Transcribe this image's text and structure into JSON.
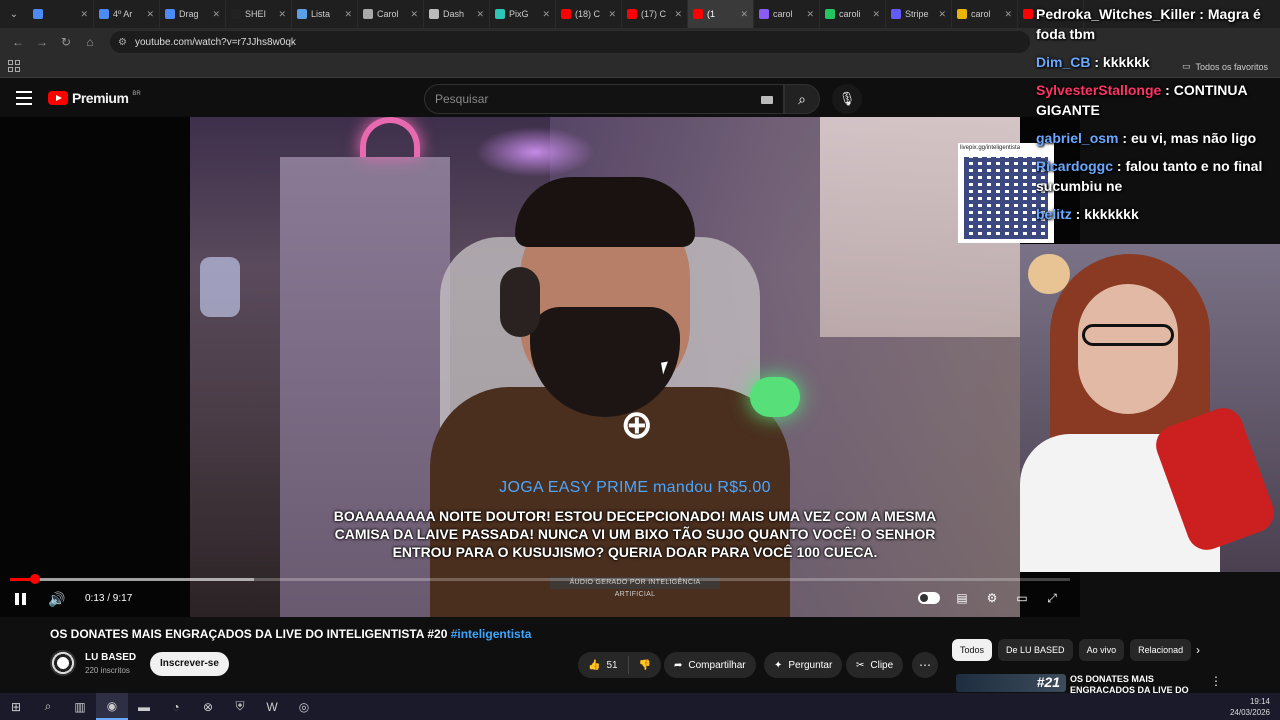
{
  "browser": {
    "tabs": [
      {
        "label": "",
        "color": "#4c8bf5",
        "active": false
      },
      {
        "label": "4º Ar",
        "color": "#4c8bf5",
        "active": false
      },
      {
        "label": "Drag",
        "color": "#4c8bf5",
        "active": false
      },
      {
        "label": "SHEI",
        "color": "#222222",
        "active": false
      },
      {
        "label": "Lista",
        "color": "#5aa0e6",
        "active": false
      },
      {
        "label": "Carol",
        "color": "#aaaaaa",
        "active": false
      },
      {
        "label": "Dash",
        "color": "#bbbbbb",
        "active": false
      },
      {
        "label": "PixG",
        "color": "#2ec4b6",
        "active": false
      },
      {
        "label": "(18) C",
        "color": "#ff0000",
        "active": false
      },
      {
        "label": "(17) C",
        "color": "#ff0000",
        "active": false
      },
      {
        "label": "(1",
        "color": "#ff0000",
        "active": true
      },
      {
        "label": "carol",
        "color": "#8a5cf6",
        "active": false
      },
      {
        "label": "caroli",
        "color": "#22c55e",
        "active": false
      },
      {
        "label": "Stripe",
        "color": "#635bff",
        "active": false
      },
      {
        "label": "carol",
        "color": "#eab308",
        "active": false
      },
      {
        "label": "(1",
        "color": "#ff0000",
        "active": false
      }
    ],
    "url": "youtube.com/watch?v=r7JJhs8w0qk",
    "bookmarks_label": "Todos os favoritos"
  },
  "youtube": {
    "brand": "Premium",
    "region": "BR",
    "search_placeholder": "Pesquisar"
  },
  "video": {
    "ai_note": "ÁUDIO GERADO POR INTELIGÊNCIA ARTIFICIAL",
    "donor_line": "JOGA EASY PRIME mandou R$5.00",
    "donor_message": "BOAAAAAAAA NOITE DOUTOR! ESTOU DECEPCIONADO! MAIS UMA VEZ COM A MESMA CAMISA DA LAIVE PASSADA! NUNCA VI UM BIXO TÃO SUJO QUANTO VOCÊ! O SENHOR ENTROU PARA O KUSUJISMO? QUERIA DOAR PARA VOCÊ 100 CUECA.",
    "time": "0:13 / 9:17",
    "progress_played": 0.024,
    "progress_buffered": 0.23,
    "qr_label": "livepix.gg/inteligentista"
  },
  "chat": [
    {
      "user": "Pedroka_Witches_Killer",
      "text": "Magra é foda tbm",
      "color": "#ffffff"
    },
    {
      "user": "Dim_CB",
      "text": "kkkkkk",
      "color": "#6aa8ff"
    },
    {
      "user": "SylvesterStallonge",
      "text": "CONTINUA GIGANTE",
      "color": "#ff3366"
    },
    {
      "user": "gabriel_osm",
      "text": "eu vi, mas não ligo",
      "color": "#6aa8ff"
    },
    {
      "user": "Ricardoggc",
      "text": "falou tanto e no final sucumbiu ne",
      "color": "#6aa8ff"
    },
    {
      "user": "belitz",
      "text": "kkkkkkk",
      "color": "#6aa8ff"
    }
  ],
  "below": {
    "title": "OS DONATES MAIS ENGRAÇADOS DA LIVE DO INTELIGENTISTA #20",
    "hashtag": "#inteligentista",
    "channel_name": "LU BASED",
    "subscribers": "220 inscritos",
    "subscribe_label": "Inscrever-se",
    "likes": "51",
    "share_label": "Compartilhar",
    "ask_label": "Perguntar",
    "clip_label": "Clipe"
  },
  "sidebar": {
    "chips": [
      "Todos",
      "De LU BASED",
      "Ao vivo",
      "Relacionad"
    ],
    "rec_number": "#21",
    "rec_title": "OS DONATES MAIS ENGRAÇADOS DA LIVE DO"
  },
  "taskbar": {
    "time": "19:14",
    "date": "24/03/2026"
  }
}
